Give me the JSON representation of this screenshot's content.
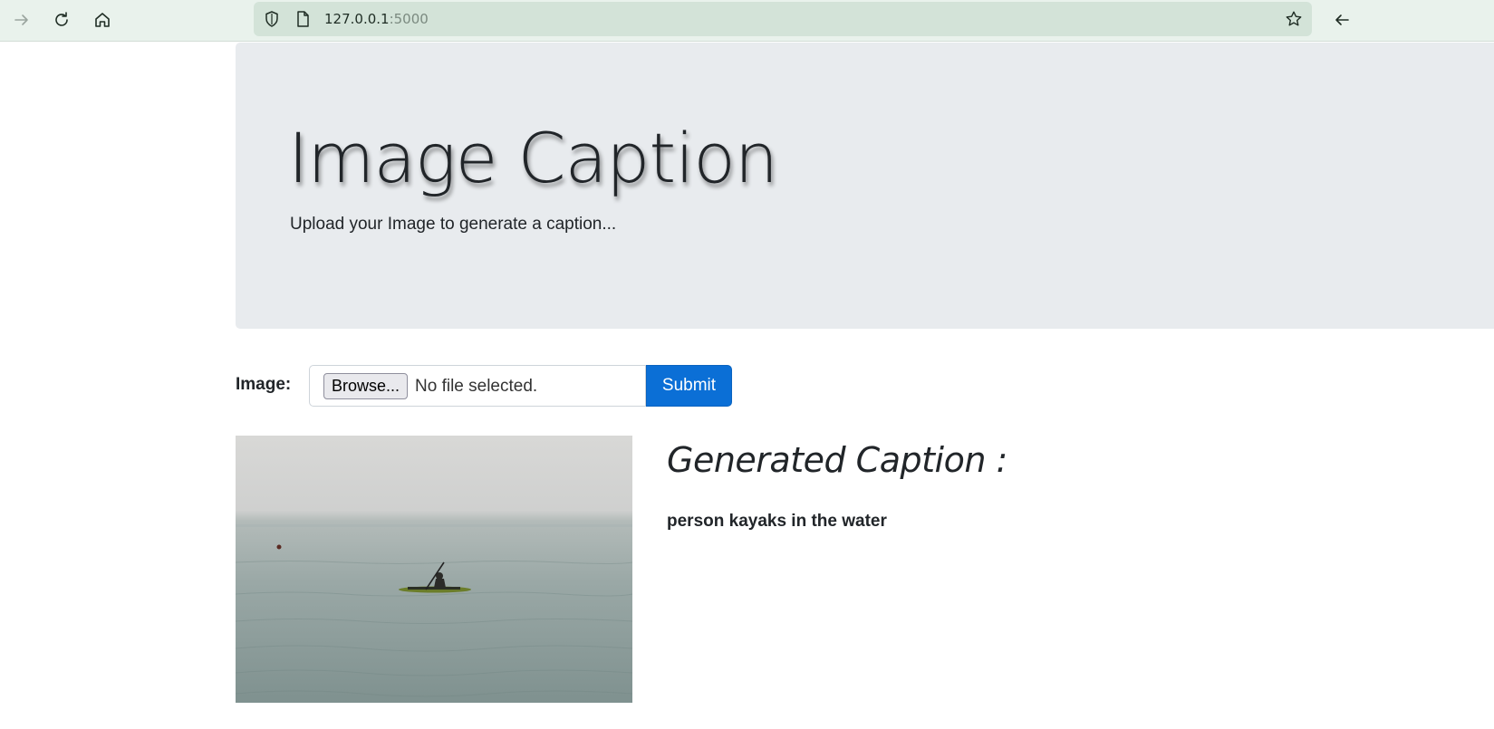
{
  "browser": {
    "url_host": "127.0.0.1",
    "url_port": ":5000",
    "icons": {
      "forward": "arrow-right-icon",
      "reload": "reload-icon",
      "home": "home-icon",
      "shield": "shield-icon",
      "page": "page-icon",
      "bookmark": "star-icon",
      "back": "arrow-left-icon"
    }
  },
  "jumbotron": {
    "title": "Image Caption",
    "subtitle": "Upload your Image to generate a caption..."
  },
  "form": {
    "label": "Image:",
    "browse_label": "Browse...",
    "file_status": "No file selected.",
    "submit_label": "Submit"
  },
  "result": {
    "heading": "Generated Caption :",
    "caption": "person kayaks in the water"
  },
  "colors": {
    "primary": "#0b6fd6",
    "jumbotron_bg": "#e8ebee",
    "toolbar_bg": "#e9f2ec"
  }
}
